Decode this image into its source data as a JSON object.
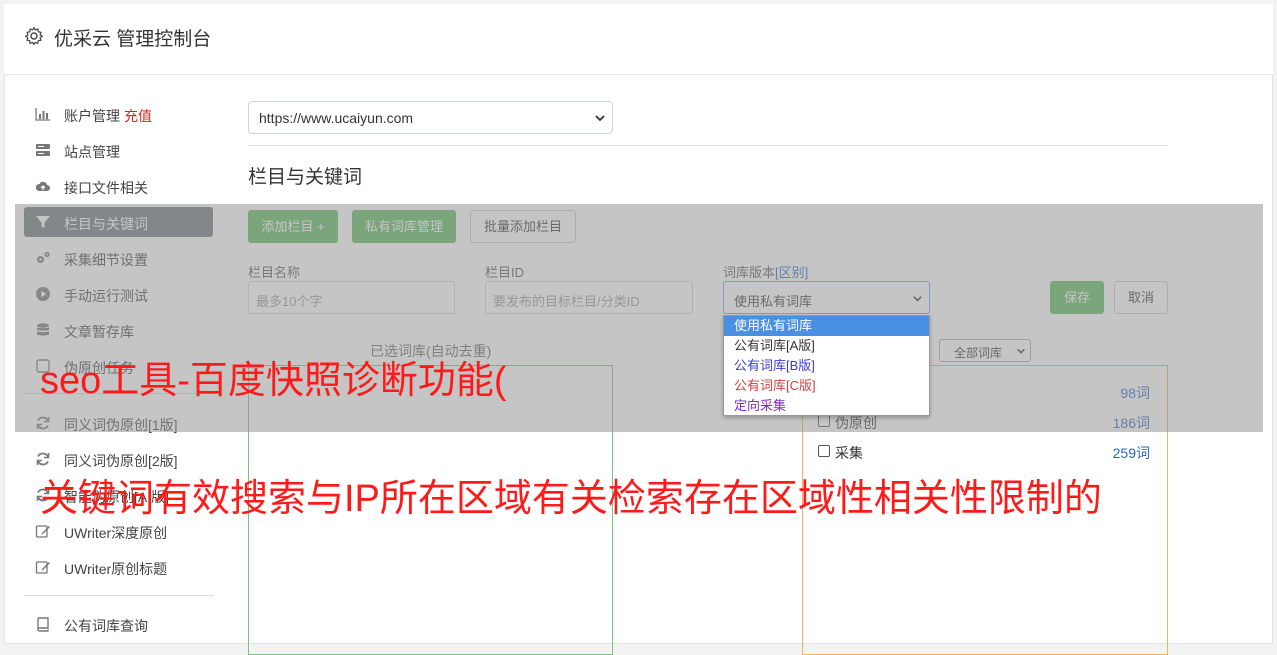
{
  "header": {
    "title": "优采云 管理控制台",
    "icon": "gear-icon"
  },
  "sidebar": {
    "items": [
      {
        "label": "账户管理",
        "extra": "充值",
        "icon": "bar-chart-icon"
      },
      {
        "label": "站点管理",
        "icon": "server-icon"
      },
      {
        "label": "接口文件相关",
        "icon": "cloud-upload-icon"
      },
      {
        "label": "栏目与关键词",
        "icon": "filter-icon",
        "active": true
      },
      {
        "label": "采集细节设置",
        "icon": "gears-icon"
      },
      {
        "label": "手动运行测试",
        "icon": "play-circle-icon"
      },
      {
        "label": "文章暂存库",
        "icon": "database-icon"
      },
      {
        "label": "伪原创任务",
        "icon": "task-icon"
      },
      {
        "label": "同义词伪原创[1版]",
        "icon": "refresh-icon"
      },
      {
        "label": "同义词伪原创[2版]",
        "icon": "refresh-icon"
      },
      {
        "label": "智能伪原创[AI版]",
        "icon": "refresh-icon"
      },
      {
        "label": "UWriter深度原创",
        "icon": "edit-icon"
      },
      {
        "label": "UWriter原创标题",
        "icon": "edit-icon"
      },
      {
        "label": "公有词库查询",
        "icon": "book-icon"
      }
    ]
  },
  "site_select": {
    "value": "https://www.ucaiyun.com"
  },
  "section": {
    "title": "栏目与关键词"
  },
  "toolbar": {
    "add_column": "添加栏目 +",
    "private_lib": "私有词库管理",
    "batch_add": "批量添加栏目"
  },
  "form": {
    "name_label": "栏目名称",
    "name_placeholder": "最多10个字",
    "id_label": "栏目ID",
    "id_placeholder": "要发布的目标栏目/分类ID",
    "lib_label": "词库版本",
    "lib_label_accent": "[区别]",
    "lib_value": "使用私有词库",
    "save": "保存",
    "cancel": "取消"
  },
  "dropdown": {
    "options": [
      {
        "label": "使用私有词库",
        "color": "#ffffff",
        "selected": true
      },
      {
        "label": "公有词库[A版]",
        "color": "#333333"
      },
      {
        "label": "公有词库[B版]",
        "color": "#3b3bd6"
      },
      {
        "label": "公有词库[C版]",
        "color": "#d0413f"
      },
      {
        "label": "定向采集",
        "color": "#7b2fc4"
      }
    ]
  },
  "panels": {
    "left_caption": "已选词库(自动去重)",
    "lib_filter": "全部词库",
    "rows": [
      {
        "name": "",
        "count": "98词"
      },
      {
        "name": "伪原创",
        "count": "186词"
      },
      {
        "name": "采集",
        "count": "259词"
      }
    ]
  },
  "banners": {
    "line1": "seo工具-百度快照诊断功能(",
    "line2": "关键词有效搜索与IP所在区域有关检索存在区域性相关性限制的"
  },
  "colors": {
    "accent_green": "#5cb85c",
    "active_nav": "#6c757d",
    "banner_red": "#ff1a1a"
  }
}
